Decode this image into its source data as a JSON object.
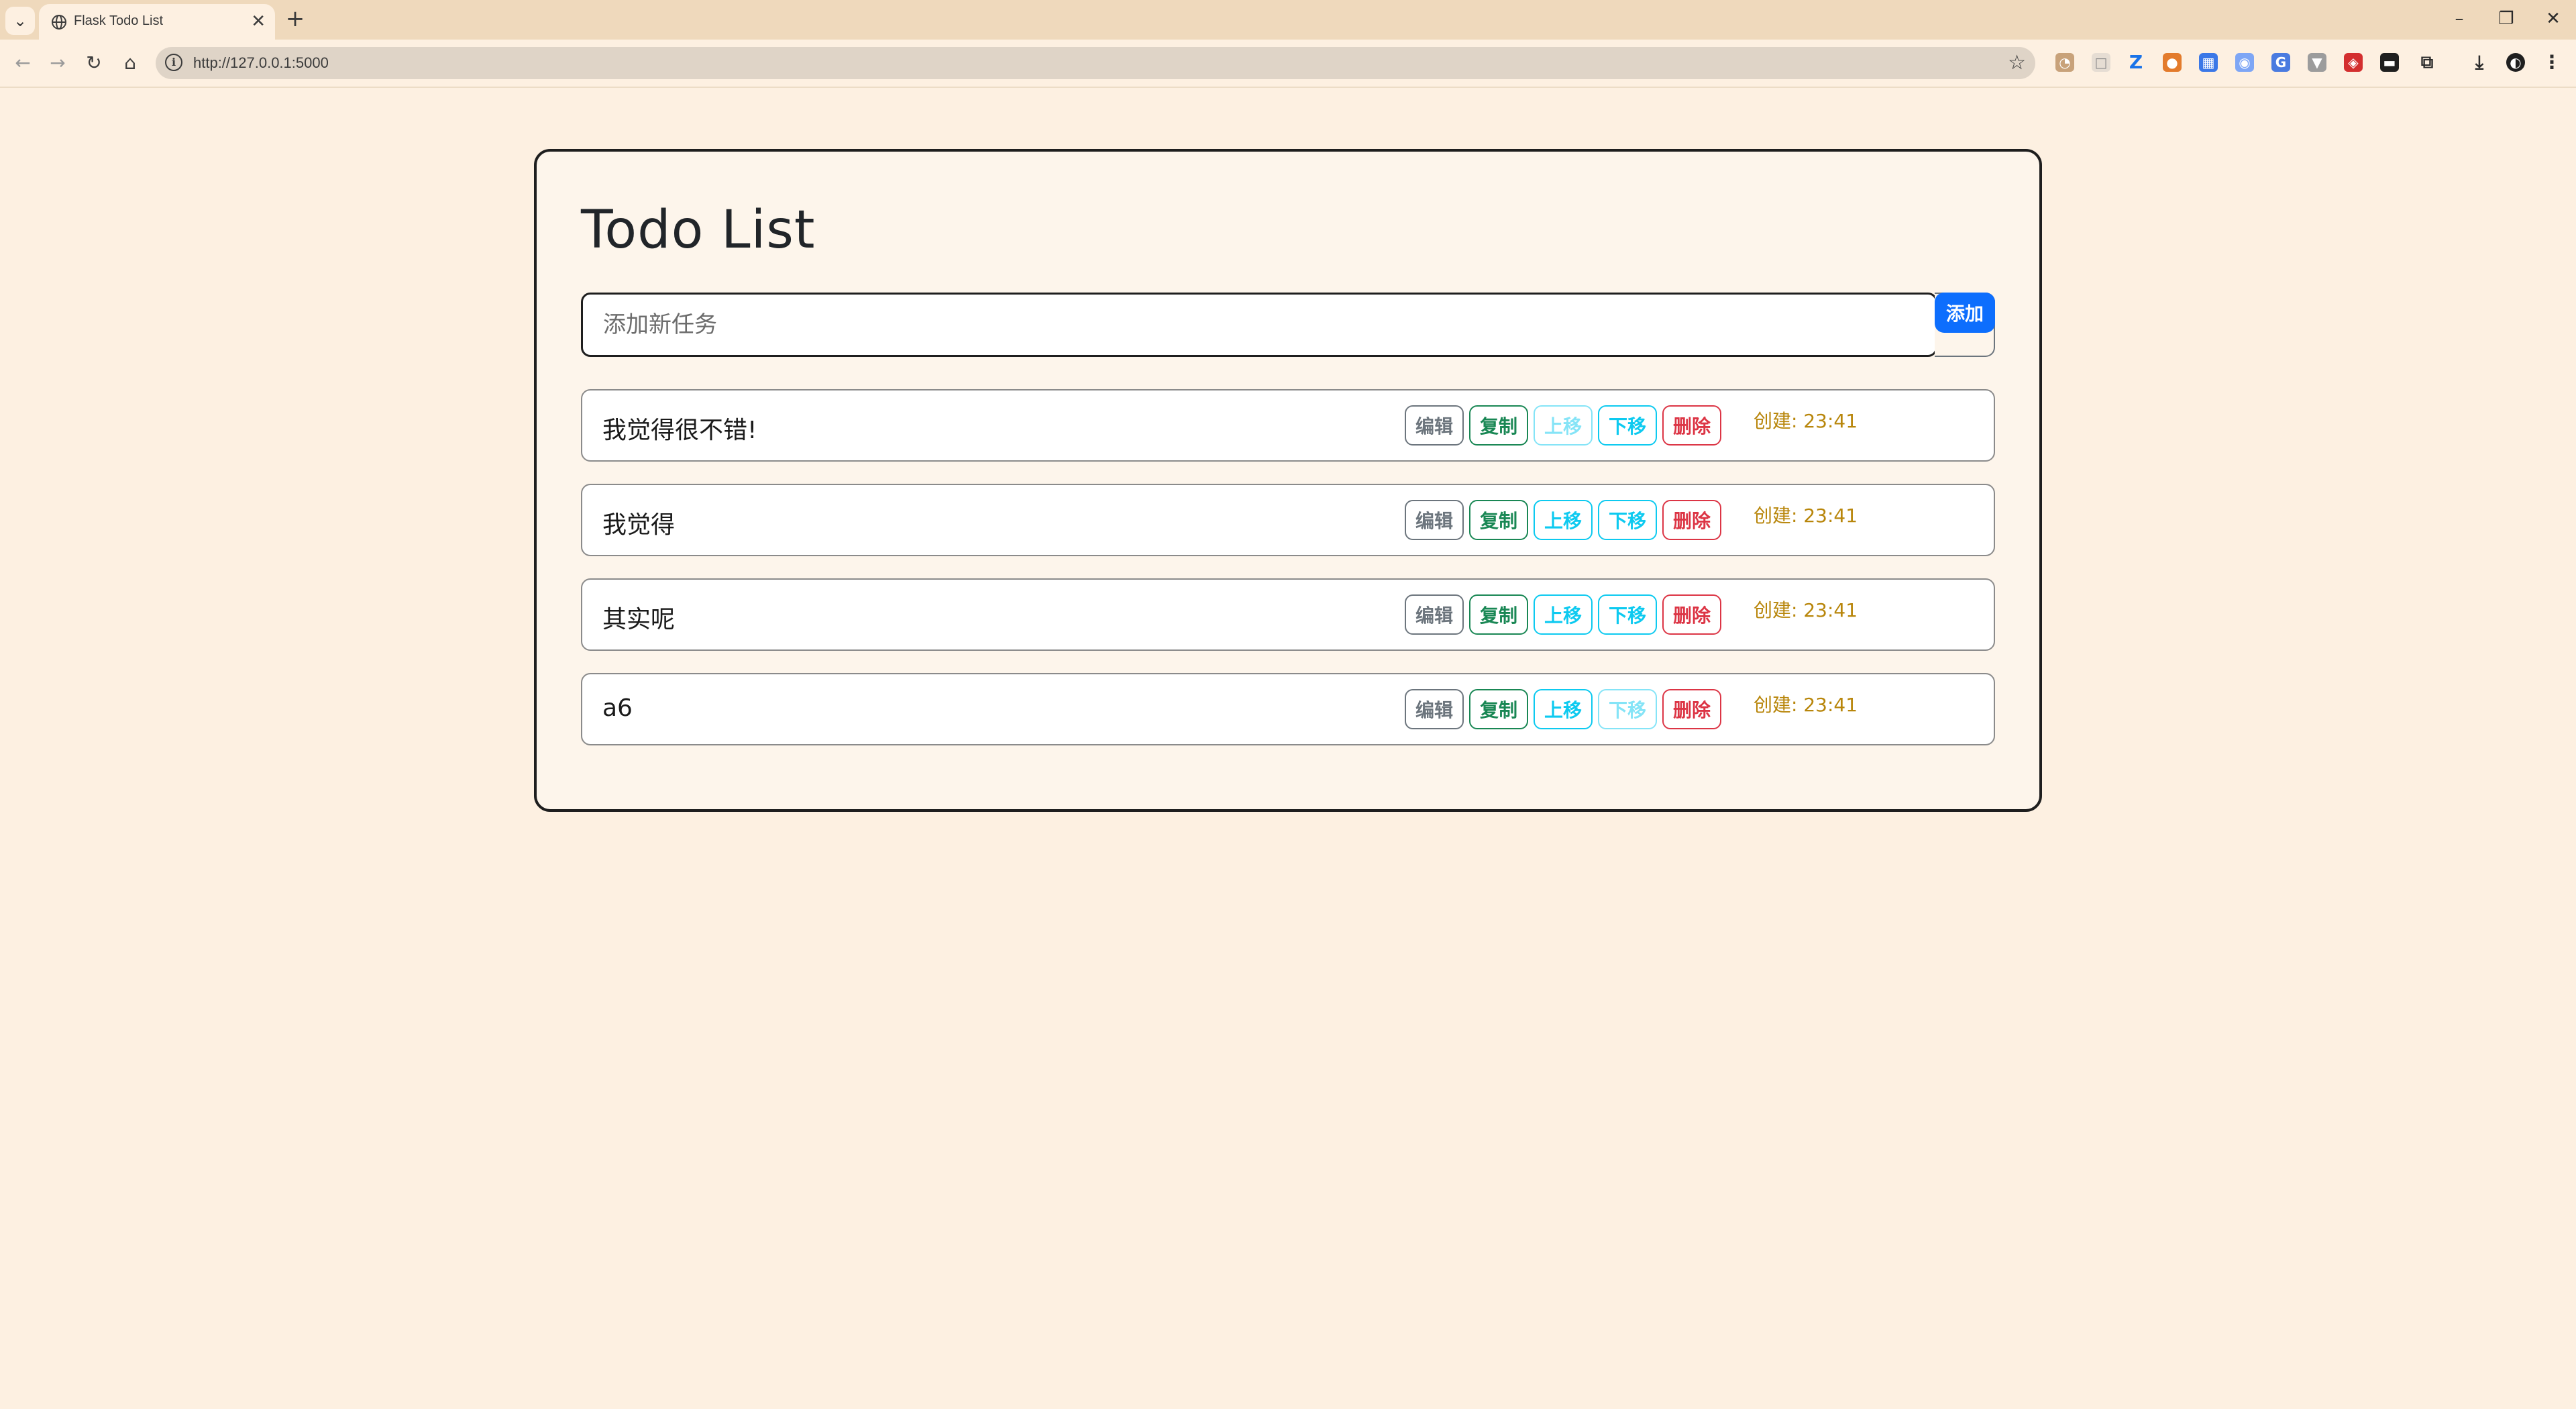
{
  "browser": {
    "tab_title": "Flask Todo List",
    "url": "http://127.0.0.1:5000"
  },
  "page": {
    "title": "Todo List",
    "input_placeholder": "添加新任务",
    "add_button": "添加"
  },
  "labels": {
    "edit": "编辑",
    "copy": "复制",
    "move_up": "上移",
    "move_down": "下移",
    "delete": "删除"
  },
  "todos": [
    {
      "text": "我觉得很不错!",
      "created": "创建: 23:41",
      "up_disabled": true,
      "down_disabled": false
    },
    {
      "text": "我觉得",
      "created": "创建: 23:41",
      "up_disabled": false,
      "down_disabled": false
    },
    {
      "text": "其实呢",
      "created": "创建: 23:41",
      "up_disabled": false,
      "down_disabled": false
    },
    {
      "text": "a6",
      "created": "创建: 23:41",
      "up_disabled": false,
      "down_disabled": true
    }
  ],
  "colors": {
    "background": "#fdf0e1",
    "primary": "#0d6efd",
    "secondary": "#6c757d",
    "success": "#198754",
    "info": "#0dcaf0",
    "danger": "#dc3545",
    "timestamp": "#b8860b"
  },
  "icons": {
    "tab_menu": "chevron-down-icon",
    "favicon": "globe-icon",
    "back": "arrow-left-icon",
    "forward": "arrow-right-icon",
    "reload": "reload-icon",
    "home": "home-icon",
    "info": "info-icon",
    "bookmark": "star-icon",
    "downloads": "download-icon",
    "profile": "profile-icon",
    "menu": "kebab-menu-icon"
  }
}
